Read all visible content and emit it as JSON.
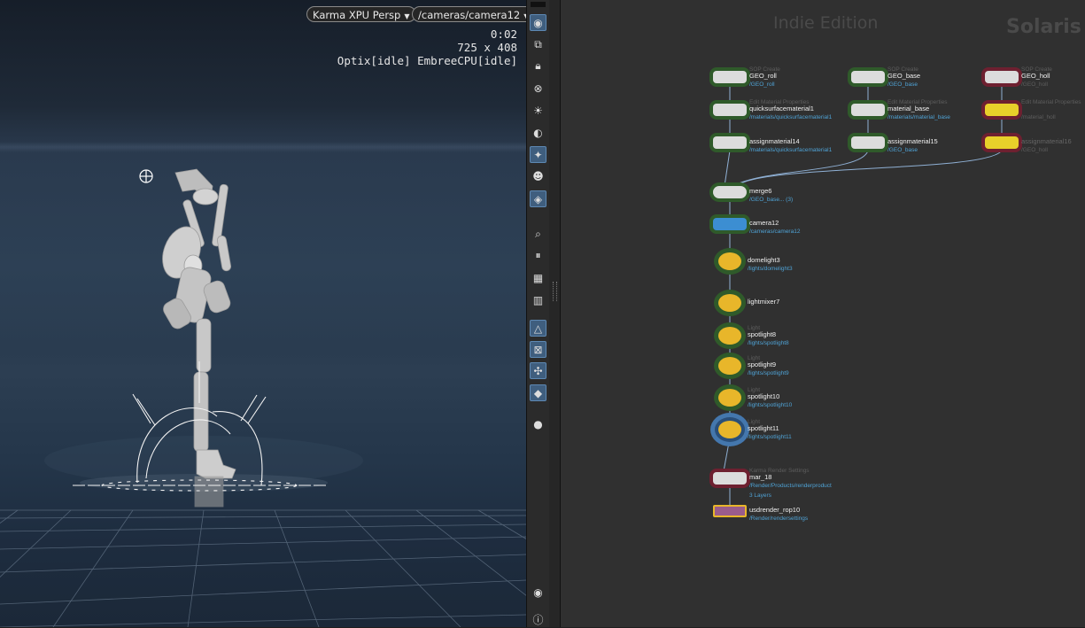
{
  "viewport": {
    "renderer_label": "Karma XPU",
    "view_mode": "Persp",
    "camera_path": "/cameras/camera12",
    "render_time": "0:02",
    "resolution": "725 x 408",
    "engine_status": "Optix[idle] EmbreeCPU[idle]"
  },
  "shelf": {
    "tools": [
      "display-options-icon",
      "snapping-icon",
      "lock-camera-icon",
      "ghost-icon",
      "headlight-icon",
      "background-icon",
      "point-light-icon",
      "gizmo-icon",
      "shadows-icon",
      "camera-icon",
      "selection-icon",
      "pause-icon",
      "object-display-icon",
      "render-layers-icon",
      "normals-icon",
      "bounding-box-icon",
      "wire-icon",
      "mask-icon",
      "ambient-occlusion-icon",
      "eye-icon",
      "info-icon"
    ]
  },
  "network": {
    "watermark": "Indie Edition",
    "context": "Solaris",
    "nodes": [
      {
        "name": "GEO_roll",
        "type": "SOP Create",
        "path": "/GEO_roll"
      },
      {
        "name": "GEO_base",
        "type": "SOP Create",
        "path": "/GEO_base"
      },
      {
        "name": "GEO_holl",
        "type": "SOP Create",
        "path": "/GEO_holl"
      },
      {
        "name": "quicksurfacematerial1",
        "type": "Edit Material Properties",
        "path": "/materials/quicksurfacematerial1"
      },
      {
        "name": "material_base",
        "type": "Edit Material Properties",
        "path": "/materials/material_base"
      },
      {
        "name": "",
        "type": "Edit Material Properties",
        "path": "/material_holl"
      },
      {
        "name": "assignmaterial14",
        "type": "",
        "path": "/materials/quicksurfacematerial1"
      },
      {
        "name": "assignmaterial15",
        "type": "",
        "path": "/GEO_base"
      },
      {
        "name": "assignmaterial16",
        "type": "",
        "path": "/GEO_holl"
      },
      {
        "name": "merge6",
        "type": "",
        "path": "/GEO_base... (3)"
      },
      {
        "name": "camera12",
        "type": "",
        "path": "/cameras/camera12"
      },
      {
        "name": "domelight3",
        "type": "",
        "path": "/lights/domelight3"
      },
      {
        "name": "lightmixer7",
        "type": "",
        "path": ""
      },
      {
        "name": "spotlight8",
        "type": "Light",
        "path": "/lights/spotlight8"
      },
      {
        "name": "spotlight9",
        "type": "Light",
        "path": "/lights/spotlight9"
      },
      {
        "name": "spotlight10",
        "type": "Light",
        "path": "/lights/spotlight10"
      },
      {
        "name": "spotlight11",
        "type": "Light",
        "path": "/lights/spotlight11"
      },
      {
        "name": "mar_18",
        "type": "Karma Render Settings",
        "path": "/Render/Products/renderproduct",
        "extra": "3 Layers"
      },
      {
        "name": "usdrender_rop10",
        "type": "",
        "path": "/Render/rendersettings"
      }
    ]
  },
  "colors": {
    "node_bypass": "#6e2030",
    "node_display": "#3a5a2a",
    "wire": "#8fb0d4",
    "light_node": "#e8b62a",
    "camera_node": "#3c8ed2",
    "path_text": "#4fa3d6"
  }
}
